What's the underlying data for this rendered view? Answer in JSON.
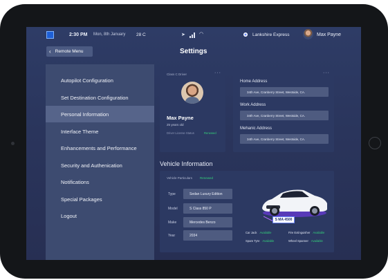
{
  "status_bar": {
    "time": "2:30 PM",
    "date": "Mon, 8th January",
    "temperature": "28 C",
    "location": "Lankshire Express",
    "user_name": "Max Payne"
  },
  "header": {
    "back_label": "Remote Menu",
    "title": "Settings"
  },
  "menu": {
    "items": [
      {
        "label": "Autopilot Configuration"
      },
      {
        "label": "Set Destination Configuration"
      },
      {
        "label": "Personal Information"
      },
      {
        "label": "Interface Theme"
      },
      {
        "label": "Enhancements and Performance"
      },
      {
        "label": "Security and Authenication"
      },
      {
        "label": "Notifications"
      },
      {
        "label": "Special Packages"
      },
      {
        "label": "Logout"
      }
    ],
    "active": "Personal Information"
  },
  "profile": {
    "caption": "Class C Driver",
    "name": "Max Payne",
    "age": "25 years old",
    "license_label": "Driver License Status",
    "license_status": "Renewed"
  },
  "addresses": [
    {
      "label": "Home Address",
      "value": "34th Ave, Cranberry Street, Westside, CA."
    },
    {
      "label": "Work Address",
      "value": "34th Ave, Cranberry Street, Westside, CA."
    },
    {
      "label": "Mehanic Address",
      "value": "34th Ave, Cranberry Street, Westside, CA."
    }
  ],
  "vehicle": {
    "title": "Vehicle Information",
    "particulars_label": "Vehicle Particulars",
    "particulars_status": "Renewed",
    "fields": [
      {
        "label": "Type",
        "value": "Sedan Luxury Edition"
      },
      {
        "label": "Model",
        "value": "S Class 850 P"
      },
      {
        "label": "Make",
        "value": "Mercedes Benzo"
      },
      {
        "label": "Year",
        "value": "2034"
      }
    ],
    "plate": "S MA 4500",
    "features": [
      {
        "label": "Car Jack",
        "status": "Available"
      },
      {
        "label": "Fire Extinguisher",
        "status": "Available"
      },
      {
        "label": "Spare Tyre",
        "status": "Available"
      },
      {
        "label": "Wheel Spanner",
        "status": "Available"
      }
    ]
  },
  "colors": {
    "accent_green": "#34d17a",
    "panel": "#3d4b70",
    "active_item": "#56648a",
    "card": "#2c3962"
  }
}
